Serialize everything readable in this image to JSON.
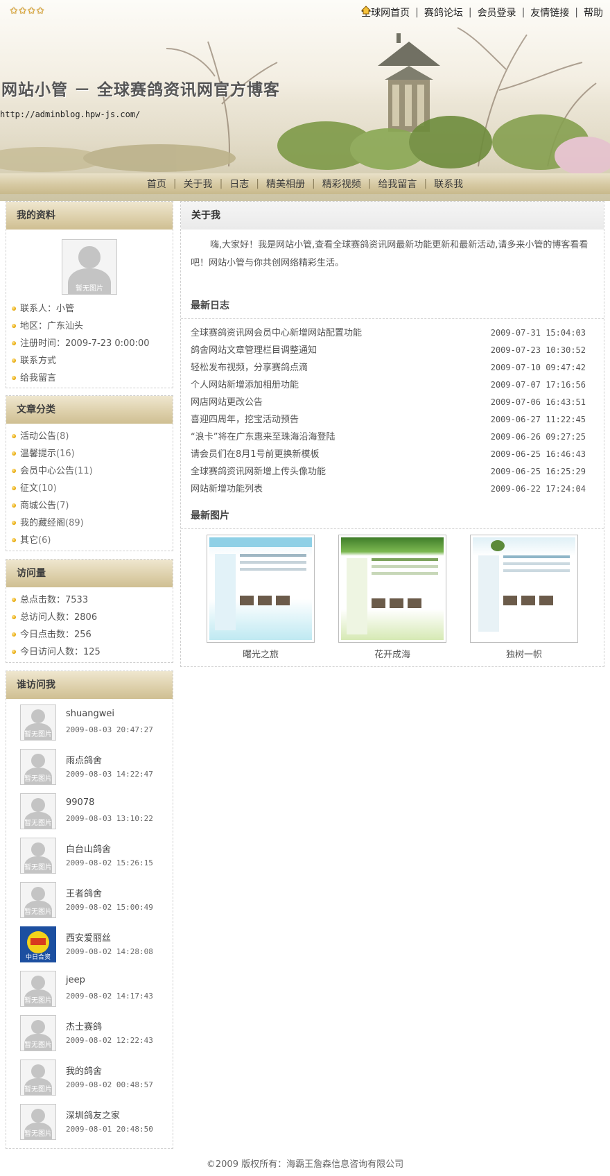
{
  "colors": {
    "accent": "#cfbf92",
    "star": "#e3a318",
    "text": "#555555"
  },
  "stars": "✩✩✩✩",
  "topnav": {
    "items": [
      "全球网首页",
      "赛鸽论坛",
      "会员登录",
      "友情链接",
      "帮助"
    ]
  },
  "header": {
    "title": "网站小管 － 全球赛鸽资讯网官方博客",
    "url": "http://adminblog.hpw-js.com/"
  },
  "mainnav": {
    "items": [
      "首页",
      "关于我",
      "日志",
      "精美相册",
      "精彩视频",
      "给我留言",
      "联系我"
    ]
  },
  "profile": {
    "title": "我的资料",
    "avatar_caption": "暂无图片",
    "items": [
      "联系人：小管",
      "地区：广东汕头",
      "注册时间：2009-7-23 0:00:00",
      "联系方式",
      "给我留言"
    ]
  },
  "categories": {
    "title": "文章分类",
    "items": [
      {
        "name": "活动公告",
        "count": "(8)"
      },
      {
        "name": "温馨提示",
        "count": "(16)"
      },
      {
        "name": "会员中心公告",
        "count": "(11)"
      },
      {
        "name": "征文",
        "count": "(10)"
      },
      {
        "name": "商城公告",
        "count": "(7)"
      },
      {
        "name": "我的藏经阁",
        "count": "(89)"
      },
      {
        "name": "其它",
        "count": "(6)"
      }
    ]
  },
  "visits": {
    "title": "访问量",
    "items": [
      "总点击数：7533",
      "总访问人数：2806",
      "今日点击数：256",
      "今日访问人数：125"
    ]
  },
  "visitors": {
    "title": "谁访问我",
    "avatar_caption": "暂无图片",
    "items": [
      {
        "name": "shuangwei",
        "time": "2009-08-03 20:47:27"
      },
      {
        "name": "雨点鸽舍",
        "time": "2009-08-03 14:22:47"
      },
      {
        "name": "99078",
        "time": "2009-08-03 13:10:22"
      },
      {
        "name": "白台山鸽舍",
        "time": "2009-08-02 15:26:15"
      },
      {
        "name": "王者鸽舍",
        "time": "2009-08-02 15:00:49"
      },
      {
        "name": "西安爱丽丝",
        "time": "2009-08-02 14:28:08",
        "logo_text": "中日合资"
      },
      {
        "name": "jeep",
        "time": "2009-08-02 14:17:43"
      },
      {
        "name": "杰士赛鸽",
        "time": "2009-08-02 12:22:43"
      },
      {
        "name": "我的鸽舍",
        "time": "2009-08-02 00:48:57"
      },
      {
        "name": "深圳鸽友之家",
        "time": "2009-08-01 20:48:50"
      }
    ]
  },
  "about": {
    "title": "关于我",
    "text": "嗨,大家好！我是网站小管,查看全球赛鸽资讯网最新功能更新和最新活动,请多来小管的博客看看吧！网站小管与你共创网络精彩生活。"
  },
  "latest_logs": {
    "title": "最新日志",
    "items": [
      {
        "title": "全球赛鸽资讯网会员中心新增网站配置功能",
        "date": "2009-07-31 15:04:03"
      },
      {
        "title": "鸽舍网站文章管理栏目调整通知",
        "date": "2009-07-23 10:30:52"
      },
      {
        "title": "轻松发布视频，分享赛鸽点滴",
        "date": "2009-07-10 09:47:42"
      },
      {
        "title": "个人网站新增添加相册功能",
        "date": "2009-07-07 17:16:56"
      },
      {
        "title": "网店网站更改公告",
        "date": "2009-07-06 16:43:51"
      },
      {
        "title": "喜迎四周年，挖宝活动预告",
        "date": "2009-06-27 11:22:45"
      },
      {
        "title": "“浪卡”将在广东惠来至珠海沿海登陆",
        "date": "2009-06-26 09:27:25"
      },
      {
        "title": "请会员们在8月1号前更换新模板",
        "date": "2009-06-25 16:46:43"
      },
      {
        "title": "全球赛鸽资讯网新增上传头像功能",
        "date": "2009-06-25 16:25:29"
      },
      {
        "title": "网站新增功能列表",
        "date": "2009-06-22 17:24:04"
      }
    ]
  },
  "latest_pics": {
    "title": "最新图片",
    "items": [
      {
        "caption": "曙光之旅",
        "color": "#bfe9f2"
      },
      {
        "caption": "花开成海",
        "color": "#d6e9b4"
      },
      {
        "caption": "独树一帜",
        "color": "#dff0f6"
      }
    ]
  },
  "footer": {
    "text": "©2009 版权所有：海霸王詹森信息咨询有限公司"
  }
}
